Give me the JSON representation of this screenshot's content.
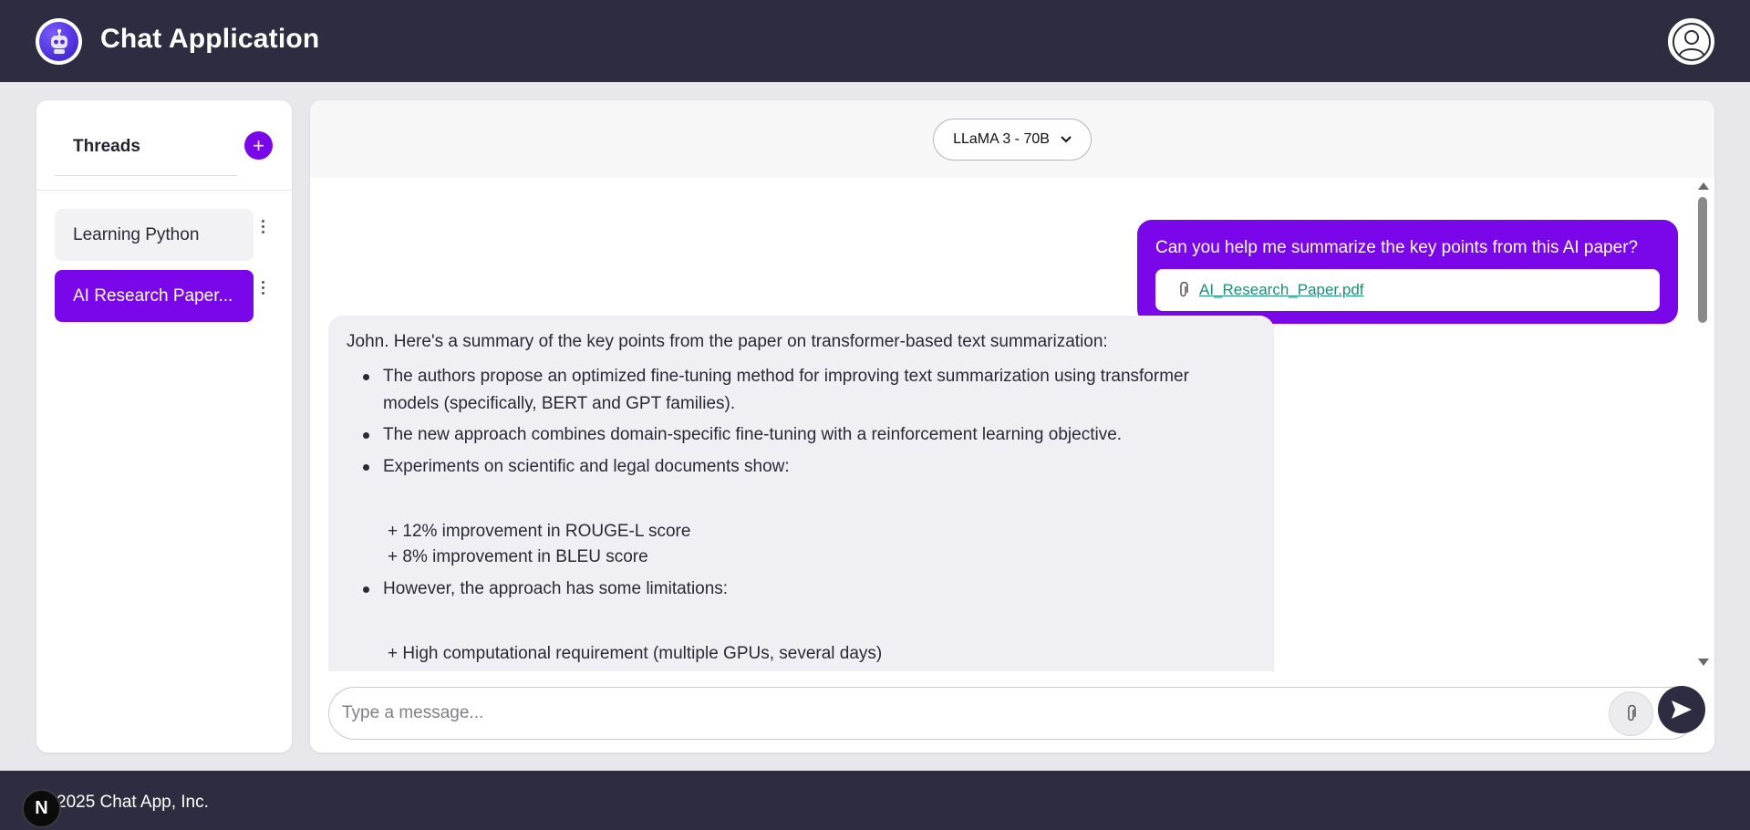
{
  "header": {
    "app_title": "Chat Application",
    "logo_icon": "robot-icon",
    "avatar_icon": "user-icon"
  },
  "sidebar": {
    "title": "Threads",
    "add_label": "+",
    "threads": [
      {
        "label": "Learning Python",
        "active": false
      },
      {
        "label": "AI Research Paper...",
        "active": true
      }
    ]
  },
  "chat": {
    "model_selected": "LLaMA 3 - 70B",
    "messages": {
      "user": {
        "text": "Can you help me summarize the key points from this AI paper?",
        "attachment_name": "AI_Research_Paper.pdf",
        "attachment_icon": "paperclip-icon"
      },
      "assistant": {
        "intro": "John. Here's a summary of the key points from the paper on transformer-based text summarization:",
        "b1": "The authors propose an optimized fine-tuning method for improving text summarization using transformer models (specifically, BERT and GPT families).",
        "b2": "The new approach combines domain-specific fine-tuning with a reinforcement learning objective.",
        "b3": "Experiments on scientific and legal documents show:",
        "b3_sub1": "+ 12% improvement in ROUGE-L score",
        "b3_sub2": "+ 8% improvement in BLEU score",
        "b4": "However, the approach has some limitations:",
        "b4_sub1": "+ High computational requirement (multiple GPUs, several days)"
      }
    },
    "input_placeholder": "Type a message...",
    "send_icon": "send-icon"
  },
  "footer": {
    "text": "2025 Chat App, Inc.",
    "badge": "N"
  },
  "colors": {
    "header_bg": "#2e2c40",
    "accent": "#7a07ea",
    "page_bg": "#e8e8ec",
    "assistant_bubble": "#f0eff4",
    "link": "#1a8f7a"
  }
}
